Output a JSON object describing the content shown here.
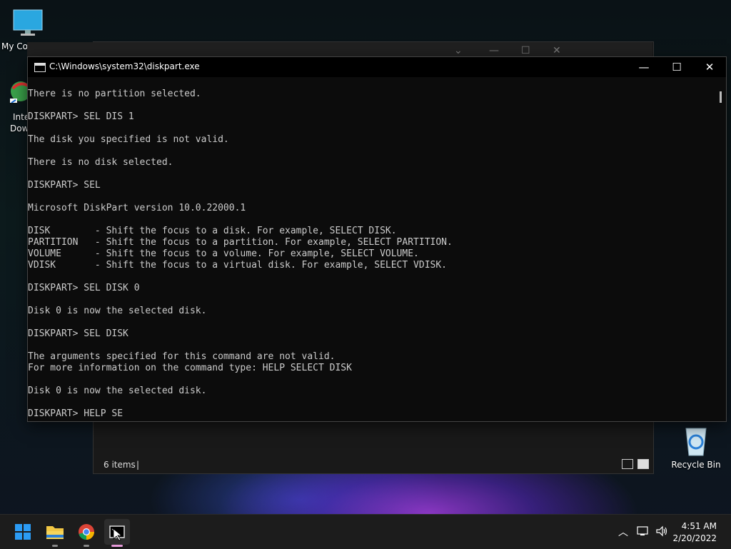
{
  "desktop": {
    "my_computer_label": "My Co",
    "idm_label_1": "Inte",
    "idm_label_2": "Dow",
    "recycle_bin_label": "Recycle Bin"
  },
  "explorer": {
    "status_items": "6 items",
    "status_cursor": "|"
  },
  "console": {
    "title": "C:\\Windows\\system32\\diskpart.exe",
    "minimize_label": "—",
    "maximize_label": "☐",
    "close_label": "✕",
    "lines": [
      "There is no partition selected.",
      "",
      "DISKPART> SEL DIS 1",
      "",
      "The disk you specified is not valid.",
      "",
      "There is no disk selected.",
      "",
      "DISKPART> SEL",
      "",
      "Microsoft DiskPart version 10.0.22000.1",
      "",
      "DISK        - Shift the focus to a disk. For example, SELECT DISK.",
      "PARTITION   - Shift the focus to a partition. For example, SELECT PARTITION.",
      "VOLUME      - Shift the focus to a volume. For example, SELECT VOLUME.",
      "VDISK       - Shift the focus to a virtual disk. For example, SELECT VDISK.",
      "",
      "DISKPART> SEL DISK 0",
      "",
      "Disk 0 is now the selected disk.",
      "",
      "DISKPART> SEL DISK",
      "",
      "The arguments specified for this command are not valid.",
      "For more information on the command type: HELP SELECT DISK",
      "",
      "Disk 0 is now the selected disk.",
      "",
      "DISKPART> HELP SE"
    ]
  },
  "taskbar": {
    "apps": [
      "start-button",
      "file-explorer",
      "chrome",
      "diskpart-console"
    ],
    "time": "4:51 AM",
    "date": "2/20/2022",
    "colors": {
      "start": "#2b9bf4",
      "folder": "#f2c744",
      "active_indicator": "#e69ad9"
    }
  }
}
